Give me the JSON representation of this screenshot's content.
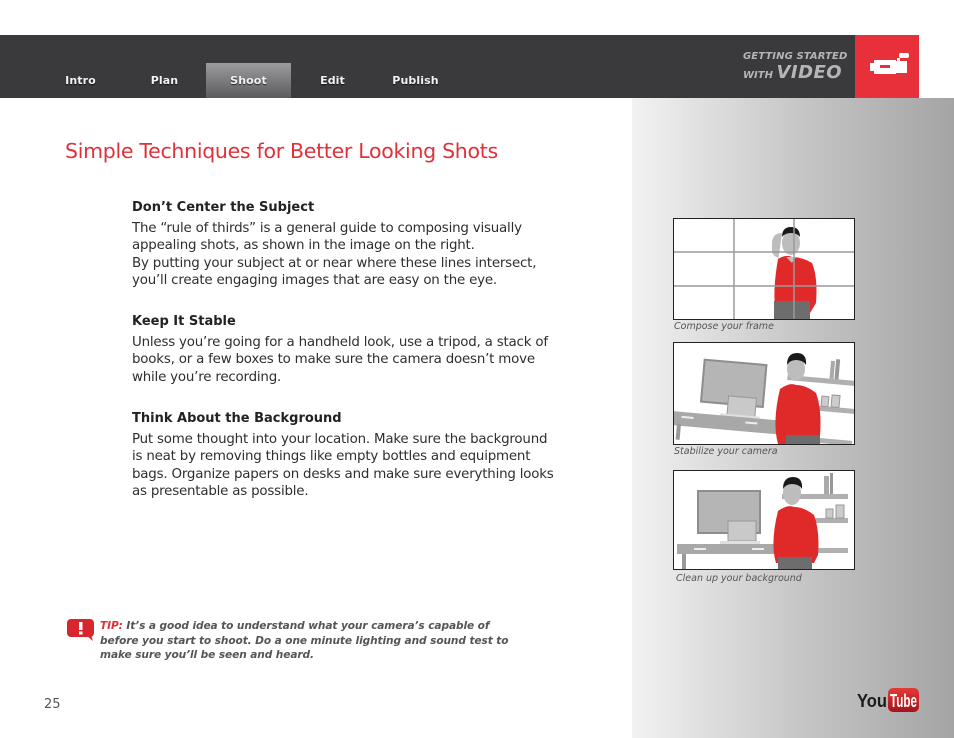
{
  "nav": {
    "tabs": [
      {
        "label": "Intro",
        "active": false
      },
      {
        "label": "Plan",
        "active": false
      },
      {
        "label": "Shoot",
        "active": true
      },
      {
        "label": "Edit",
        "active": false
      },
      {
        "label": "Publish",
        "active": false
      }
    ],
    "brand_line1": "GETTING STARTED",
    "brand_with": "WITH",
    "brand_video": "VIDEO",
    "brand_icon": "video-camera-icon"
  },
  "colors": {
    "accent_red": "#e8303a",
    "title_red": "#e03039",
    "nav_dark": "#3a3a3c"
  },
  "page": {
    "title": "Simple Techniques for Better Looking Shots",
    "sections": [
      {
        "heading": "Don’t Center the Subject",
        "body": "The “rule of thirds” is a general guide to composing visually appealing shots, as shown in the image on the right.\nBy putting your subject at or near where these lines intersect, you’ll create engaging images that are easy on the eye."
      },
      {
        "heading": "Keep It Stable",
        "body": "Unless you’re going for a handheld look, use a tripod, a stack of books, or a few boxes to make sure the camera doesn’t move while you’re recording."
      },
      {
        "heading": "Think About the Background",
        "body": "Put some thought into your location. Make sure the background is neat by removing things like empty bottles and equipment bags. Organize papers on desks and make sure everything looks as presentable as possible."
      }
    ],
    "tip": {
      "lead": "TIP:",
      "text": " It’s a good idea to understand what your camera’s capable of before you start to shoot. Do a one minute lighting and sound test to make sure you’ll be seen and heard.",
      "icon": "exclamation-bubble-icon"
    },
    "page_number": "25"
  },
  "figures": [
    {
      "caption": "Compose your frame",
      "illustration": "rule-of-thirds-grid"
    },
    {
      "caption": "Stabilize your camera",
      "illustration": "tilted-room-scene"
    },
    {
      "caption": "Clean up your background",
      "illustration": "level-room-scene"
    }
  ],
  "footer": {
    "logo_you": "You",
    "logo_tube": "Tube"
  }
}
